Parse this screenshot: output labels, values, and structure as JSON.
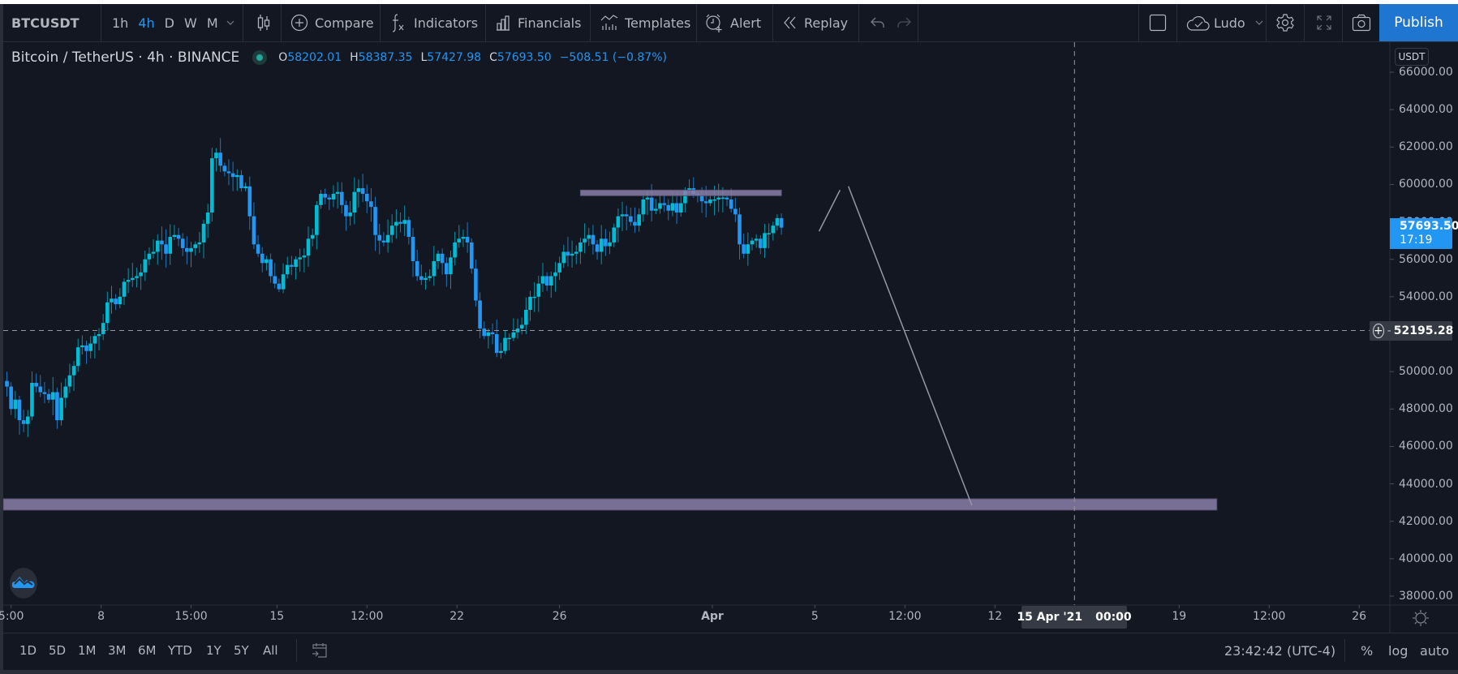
{
  "toolbar": {
    "symbol": "BTCUSDT",
    "timeframes": [
      {
        "label": "1h",
        "active": false
      },
      {
        "label": "4h",
        "active": true
      },
      {
        "label": "D",
        "active": false
      },
      {
        "label": "W",
        "active": false
      },
      {
        "label": "M",
        "active": false
      }
    ],
    "compare_label": "Compare",
    "indicators_label": "Indicators",
    "financials_label": "Financials",
    "templates_label": "Templates",
    "alert_label": "Alert",
    "replay_label": "Replay",
    "account_label": "Ludo",
    "publish_label": "Publish"
  },
  "legend": {
    "title": "Bitcoin / TetherUS · 4h · BINANCE",
    "open_prefix": "O",
    "open": "58202.01",
    "high_prefix": "H",
    "high": "58387.35",
    "low_prefix": "L",
    "low": "57427.98",
    "close_prefix": "C",
    "close": "57693.50",
    "change": "−508.51 (−0.87%)"
  },
  "price_axis": {
    "currency": "USDT",
    "current_price": "57693.50",
    "countdown": "17:19",
    "crosshair_price": "52195.28"
  },
  "time_axis": {
    "crosshair_date": "15 Apr '21",
    "crosshair_time": "00:00"
  },
  "bottom_bar": {
    "ranges": [
      "1D",
      "5D",
      "1M",
      "3M",
      "6M",
      "YTD",
      "1Y",
      "5Y",
      "All"
    ],
    "clock": "23:42:42 (UTC-4)",
    "percent_label": "%",
    "log_label": "log",
    "auto_label": "auto"
  },
  "colors": {
    "background": "#131722",
    "up": "#00bcd4",
    "down": "#2196f3",
    "accent": "#2196f3",
    "publish": "#1e76d1",
    "zone": "#8b7fa8"
  },
  "chart_data": {
    "type": "candlestick",
    "title": "Bitcoin / TetherUS · 4h · BINANCE",
    "timeframe": "4h",
    "ylim": [
      37200,
      67200
    ],
    "y_ticks": [
      66000,
      64000,
      62000,
      60000,
      58000,
      56000,
      54000,
      52000,
      50000,
      48000,
      46000,
      44000,
      42000,
      40000,
      38000
    ],
    "y_tick_labels": [
      "66000.00",
      "64000.00",
      "62000.00",
      "60000.00",
      "58000.00",
      "56000.00",
      "54000.00",
      "52000.00",
      "50000.00",
      "48000.00",
      "46000.00",
      "44000.00",
      "42000.00",
      "40000.00",
      "38000.00"
    ],
    "x_ticks": [
      {
        "label": "5:00",
        "bar": 1
      },
      {
        "label": "8",
        "bar": 22.5
      },
      {
        "label": "15:00",
        "bar": 44
      },
      {
        "label": "15",
        "bar": 64.5
      },
      {
        "label": "12:00",
        "bar": 86
      },
      {
        "label": "22",
        "bar": 107.5
      },
      {
        "label": "26",
        "bar": 132
      },
      {
        "label": "Apr",
        "bar": 168.5
      },
      {
        "label": "5",
        "bar": 193
      },
      {
        "label": "12:00",
        "bar": 214.5
      },
      {
        "label": "12",
        "bar": 236
      },
      {
        "label": "19",
        "bar": 280
      },
      {
        "label": "12:00",
        "bar": 301.5
      },
      {
        "label": "26",
        "bar": 323
      }
    ],
    "closes": [
      49200,
      48000,
      48500,
      47400,
      47200,
      47600,
      49400,
      49200,
      48900,
      48800,
      48500,
      48900,
      47400,
      48600,
      49200,
      49800,
      50300,
      51300,
      51400,
      51100,
      51500,
      51900,
      52000,
      52600,
      53700,
      53900,
      53600,
      54000,
      54800,
      54900,
      55000,
      55100,
      55300,
      56000,
      56300,
      56400,
      57000,
      56800,
      56300,
      57200,
      57300,
      57100,
      56600,
      56400,
      56600,
      56800,
      56900,
      57900,
      58500,
      61400,
      61700,
      61000,
      60700,
      60600,
      60400,
      60500,
      59800,
      59900,
      58300,
      56800,
      56300,
      55800,
      56000,
      55100,
      54700,
      54400,
      55200,
      55700,
      55600,
      56000,
      56100,
      56200,
      57100,
      57300,
      58900,
      59500,
      59300,
      59200,
      59500,
      59600,
      58900,
      58300,
      58500,
      59600,
      59800,
      59500,
      59100,
      58800,
      57300,
      57000,
      56900,
      57300,
      57800,
      58000,
      57900,
      58100,
      57200,
      55900,
      55100,
      54900,
      55000,
      55100,
      55900,
      56300,
      55800,
      55200,
      56100,
      56900,
      57100,
      57200,
      56900,
      55500,
      53800,
      52300,
      51900,
      52100,
      52000,
      51000,
      51100,
      51800,
      51800,
      52100,
      52300,
      52500,
      53300,
      54000,
      54000,
      54700,
      55100,
      54600,
      55100,
      55300,
      55800,
      56400,
      56200,
      56300,
      56400,
      56900,
      57100,
      57300,
      56800,
      56400,
      57100,
      56700,
      56900,
      57700,
      58300,
      58400,
      58300,
      58000,
      57800,
      58400,
      59200,
      59300,
      58600,
      58700,
      59000,
      58900,
      58600,
      59000,
      58500,
      59000,
      59700,
      59800,
      59500,
      59400,
      59100,
      59000,
      59200,
      59200,
      59300,
      59300,
      59200,
      58700,
      58400,
      56800,
      56300,
      56800,
      57000,
      57100,
      56600,
      57400,
      57400,
      57800,
      58200,
      57693
    ],
    "drawings": [
      {
        "type": "rectangle",
        "name": "resistance-zone",
        "bar_start": 137,
        "bar_end": 185,
        "price_top": 59700,
        "price_bottom": 59400
      },
      {
        "type": "rectangle",
        "name": "support-zone",
        "bar_start": 0,
        "bar_end": 289,
        "price_top": 43200,
        "price_bottom": 42600
      },
      {
        "type": "polyline",
        "name": "projection-line",
        "points": [
          {
            "bar": 194,
            "price": 57500
          },
          {
            "bar": 199,
            "price": 59700
          }
        ]
      },
      {
        "type": "polyline",
        "name": "projection-line-down",
        "points": [
          {
            "bar": 201,
            "price": 59900
          },
          {
            "bar": 230.5,
            "price": 42850
          }
        ]
      }
    ],
    "crosshair": {
      "bar": 255,
      "price": 52195.28
    }
  }
}
